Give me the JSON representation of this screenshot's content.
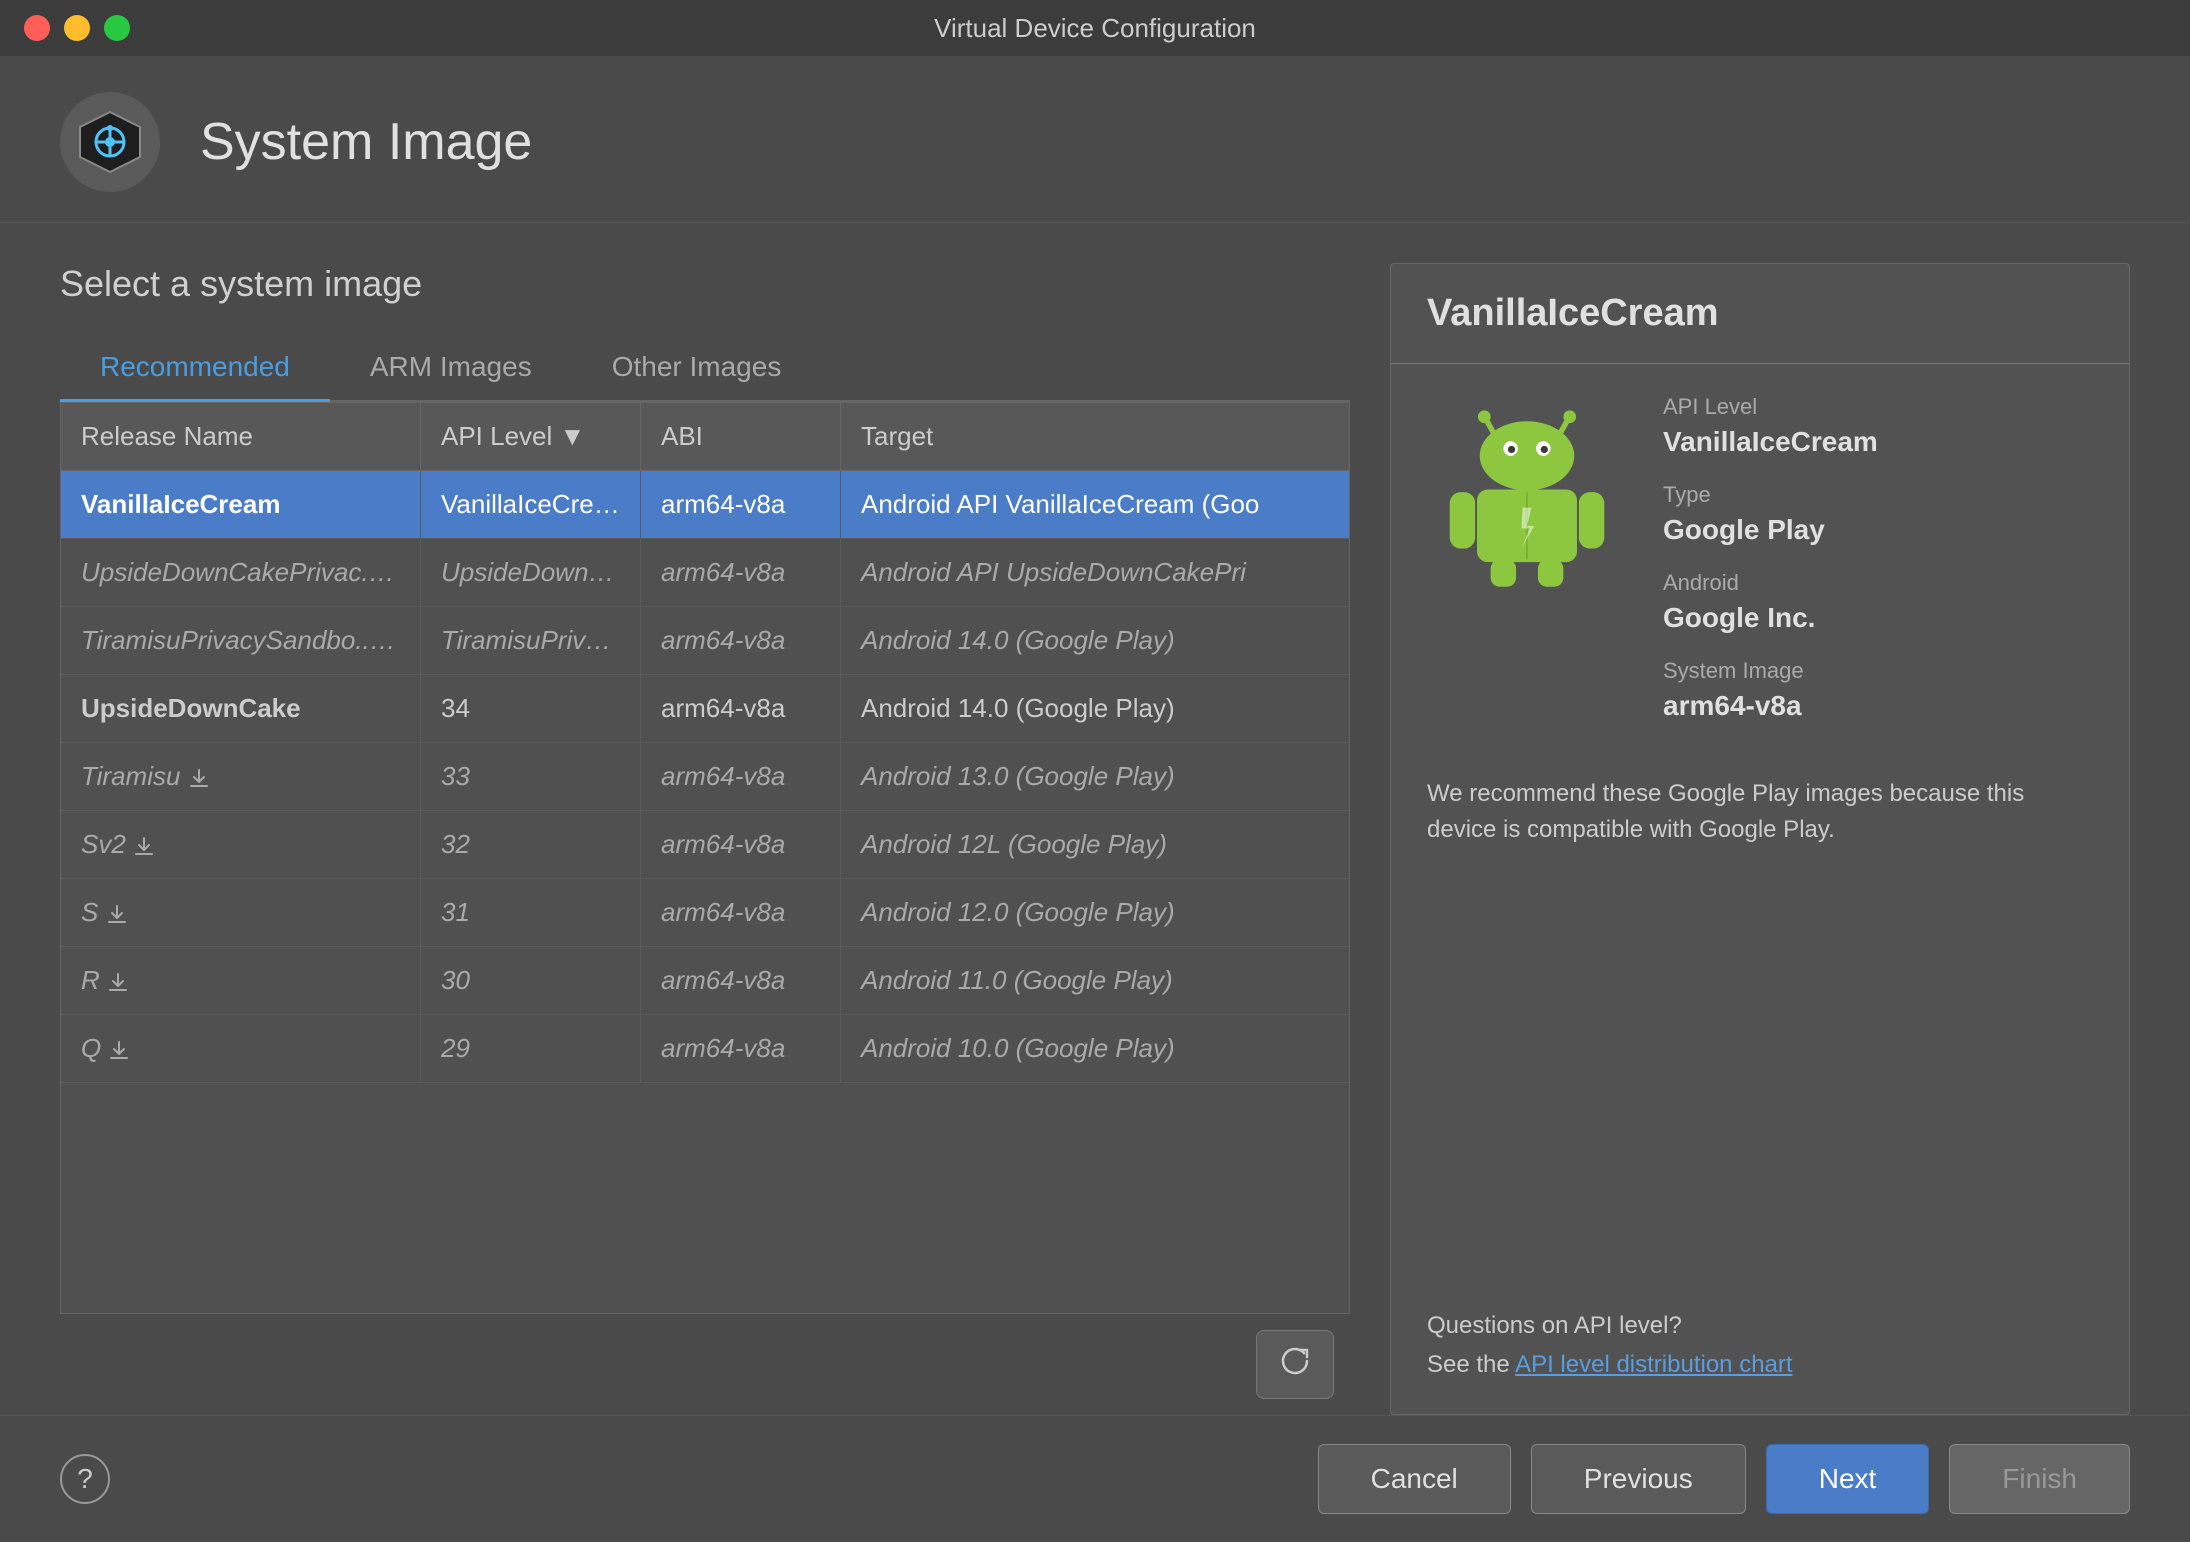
{
  "titlebar": {
    "title": "Virtual Device Configuration"
  },
  "header": {
    "title": "System Image"
  },
  "main": {
    "section_title": "Select a system image",
    "tabs": [
      {
        "label": "Recommended",
        "active": true
      },
      {
        "label": "ARM Images",
        "active": false
      },
      {
        "label": "Other Images",
        "active": false
      }
    ],
    "table": {
      "columns": [
        {
          "label": "Release Name",
          "key": "release"
        },
        {
          "label": "API Level ▼",
          "key": "api"
        },
        {
          "label": "ABI",
          "key": "abi"
        },
        {
          "label": "Target",
          "key": "target"
        }
      ],
      "rows": [
        {
          "release": "VanillaIceCream",
          "api": "VanillaIceCream",
          "abi": "arm64-v8a",
          "target": "Android API VanillaIceCream (Goo",
          "selected": true,
          "italic": false,
          "download": false
        },
        {
          "release": "UpsideDownCakePrivac...",
          "api": "UpsideDownCak",
          "abi": "arm64-v8a",
          "target": "Android API UpsideDownCakePri",
          "selected": false,
          "italic": true,
          "download": true
        },
        {
          "release": "TiramisuPrivacySandbo...",
          "api": "TiramisuPrivacyS",
          "abi": "arm64-v8a",
          "target": "Android 14.0 (Google Play)",
          "selected": false,
          "italic": true,
          "download": true
        },
        {
          "release": "UpsideDownCake",
          "api": "34",
          "abi": "arm64-v8a",
          "target": "Android 14.0 (Google Play)",
          "selected": false,
          "italic": false,
          "download": false
        },
        {
          "release": "Tiramisu",
          "api": "33",
          "abi": "arm64-v8a",
          "target": "Android 13.0 (Google Play)",
          "selected": false,
          "italic": true,
          "download": true
        },
        {
          "release": "Sv2",
          "api": "32",
          "abi": "arm64-v8a",
          "target": "Android 12L (Google Play)",
          "selected": false,
          "italic": true,
          "download": true
        },
        {
          "release": "S",
          "api": "31",
          "abi": "arm64-v8a",
          "target": "Android 12.0 (Google Play)",
          "selected": false,
          "italic": true,
          "download": true
        },
        {
          "release": "R",
          "api": "30",
          "abi": "arm64-v8a",
          "target": "Android 11.0 (Google Play)",
          "selected": false,
          "italic": true,
          "download": true
        },
        {
          "release": "Q",
          "api": "29",
          "abi": "arm64-v8a",
          "target": "Android 10.0 (Google Play)",
          "selected": false,
          "italic": true,
          "download": true
        }
      ]
    }
  },
  "sidebar": {
    "title": "VanillaIceCream",
    "api_level_label": "API Level",
    "api_level_value": "VanillaIceCream",
    "type_label": "Type",
    "type_value": "Google Play",
    "android_label": "Android",
    "android_value": "Google Inc.",
    "system_image_label": "System Image",
    "system_image_value": "arm64-v8a",
    "description": "We recommend these Google Play images because this device is compatible with Google Play.",
    "questions_text": "Questions on API level?",
    "see_text": "See the",
    "link_text": "API level distribution chart"
  },
  "footer": {
    "help_label": "?",
    "cancel_label": "Cancel",
    "previous_label": "Previous",
    "next_label": "Next",
    "finish_label": "Finish"
  }
}
